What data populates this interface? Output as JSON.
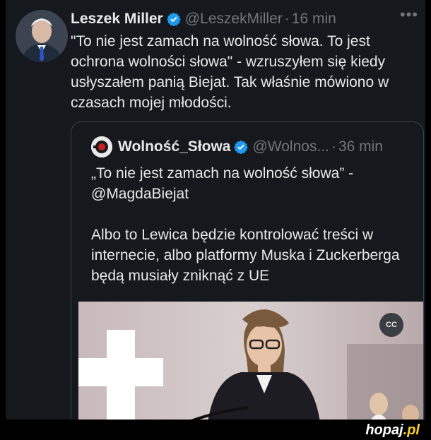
{
  "tweet": {
    "author_name": "Leszek Miller",
    "handle": "@LeszekMiller",
    "separator": "·",
    "time": "16 min",
    "more_icon": "more-icon",
    "text": "\"To nie jest zamach na wolność słowa. To jest ochrona wolności słowa\" - wzruszyłem się kiedy usłyszałem panią Biejat. Tak właśnie mówiono w czasach mojej młodości."
  },
  "quote": {
    "author_name": "Wolność_Słowa",
    "handle": "@Wolnos...",
    "separator": "·",
    "time": "36 min",
    "text": "„To nie jest zamach na wolność słowa” - @MagdaBiejat\n\nAlbo to Lewica będzie kontrolować treści w internecie, albo platformy Muska i Zuckerberga będą musiały zniknąć z UE",
    "cc_label": "CC"
  },
  "footer": {
    "logo_main": "hopaj",
    "logo_tld": ".pl"
  },
  "colors": {
    "verified": "#1d9bf0",
    "background": "#15181c",
    "muted": "#71767b"
  }
}
